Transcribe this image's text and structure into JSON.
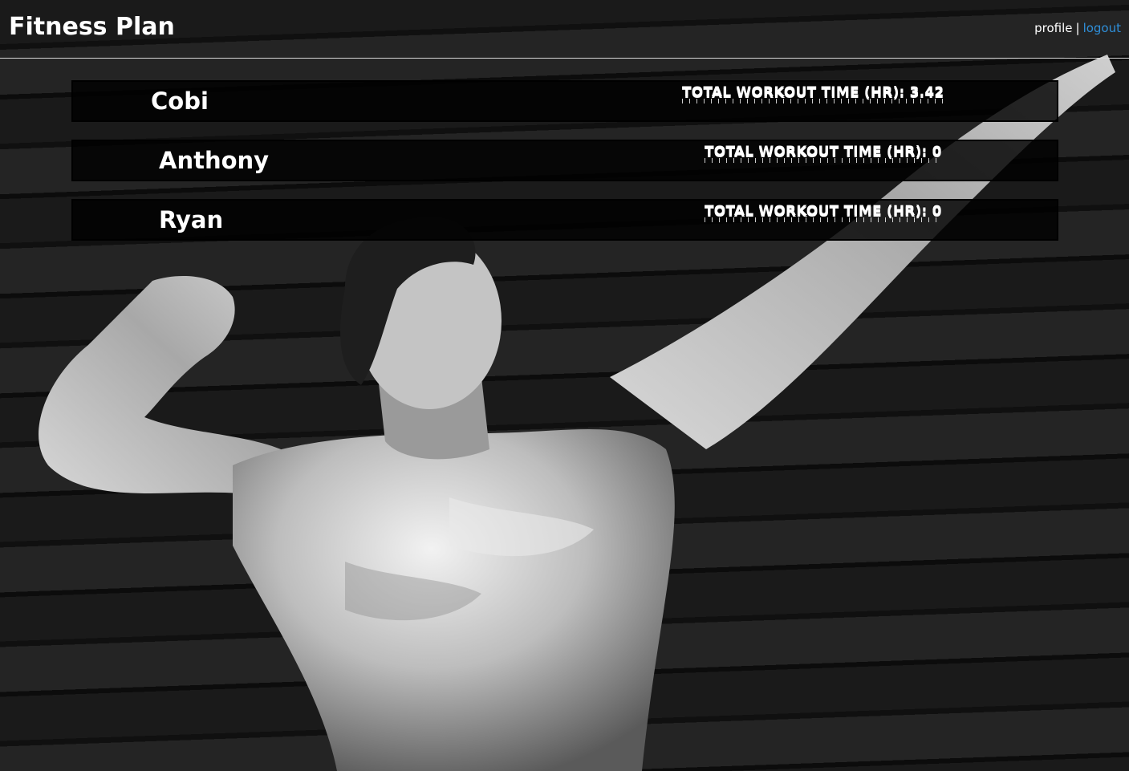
{
  "header": {
    "title": "Fitness Plan",
    "nav": {
      "profile_label": "profile",
      "separator": "|",
      "logout_label": "logout",
      "logout_color": "#2f8fd9"
    }
  },
  "background": {
    "icon": "bodybuilder-photo"
  },
  "users": [
    {
      "name": "Cobi",
      "total_time_label": "TOTAL WORKOUT TIME (HR): 3.42"
    },
    {
      "name": "Anthony",
      "total_time_label": "TOTAL WORKOUT TIME (HR): 0"
    },
    {
      "name": "Ryan",
      "total_time_label": "TOTAL WORKOUT TIME (HR): 0"
    }
  ]
}
